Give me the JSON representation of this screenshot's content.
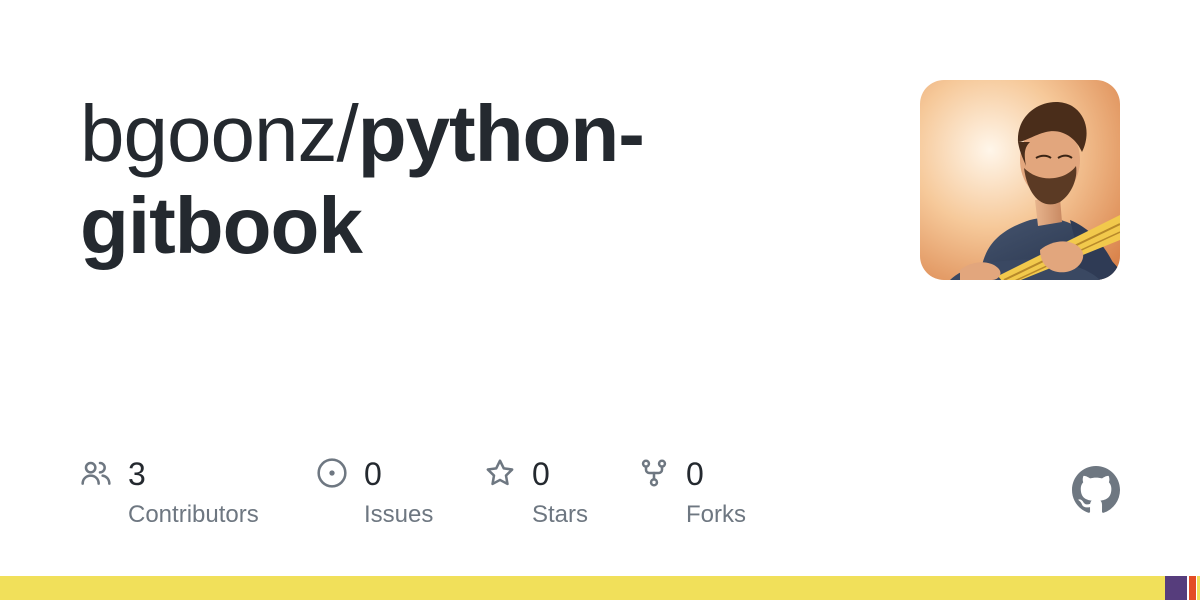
{
  "repo": {
    "owner": "bgoonz/",
    "name": "python-gitbook"
  },
  "stats": [
    {
      "count": "3",
      "label": "Contributors",
      "icon": "people-icon"
    },
    {
      "count": "0",
      "label": "Issues",
      "icon": "issue-opened-icon"
    },
    {
      "count": "0",
      "label": "Stars",
      "icon": "star-icon"
    },
    {
      "count": "0",
      "label": "Forks",
      "icon": "repo-forked-icon"
    }
  ],
  "colors": {
    "text": "#24292f",
    "muted": "#6e7781",
    "icon": "#6e7781",
    "logo": "#6e7781"
  },
  "language_bar": [
    {
      "color": "#f1e05a",
      "fraction": 0.971
    },
    {
      "color": "#563d7c",
      "fraction": 0.018
    },
    {
      "color": "#ffffff",
      "fraction": 0.002
    },
    {
      "color": "#e34c26",
      "fraction": 0.006
    },
    {
      "color": "#ffffff",
      "fraction": 0.001
    },
    {
      "color": "#f1e05a",
      "fraction": 0.002
    }
  ]
}
